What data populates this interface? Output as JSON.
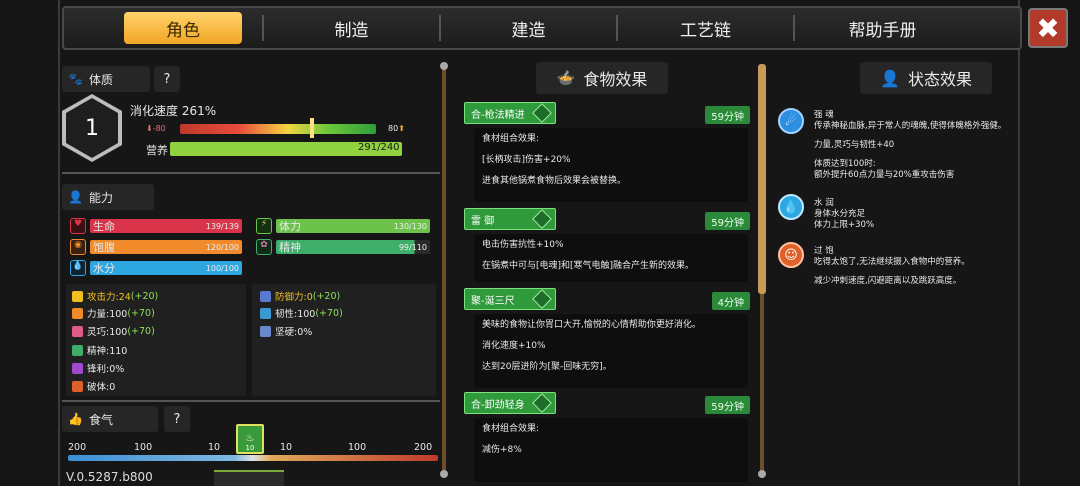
{
  "tabs": [
    "角色",
    "制造",
    "建造",
    "工艺链",
    "帮助手册"
  ],
  "close_symbol": "✖",
  "constitution": {
    "label": "体质",
    "help": "?",
    "level": "1",
    "digest_speed": "消化速度 261%",
    "digest_min": "-80",
    "digest_max": "80",
    "nutrition_label": "营养",
    "nutrition_value": "291/240",
    "nutrition_fraction": 1.0
  },
  "ability": {
    "label": "能力",
    "bars": [
      {
        "name": "生命",
        "value": "139/139",
        "color": "#d9344a"
      },
      {
        "name": "体力",
        "value": "130/130",
        "color": "#6cc24a"
      },
      {
        "name": "饱腹",
        "value": "120/100",
        "color": "#f08a2a"
      },
      {
        "name": "精神",
        "value": "99/110",
        "color": "#3fae6a"
      },
      {
        "name": "水分",
        "value": "100/100",
        "color": "#2ea7e0"
      }
    ],
    "attrs_left": [
      {
        "text": "攻击力:24",
        "bonus": "(+20)",
        "color": "#f0c020"
      },
      {
        "text": "力量:100",
        "bonus": "(+70)",
        "color": "#f08a2a"
      },
      {
        "text": "灵巧:100",
        "bonus": "(+70)",
        "color": "#e05a8a"
      },
      {
        "text": "精神:110",
        "bonus": "",
        "color": "#3fae6a"
      },
      {
        "text": "锋利:0%",
        "bonus": "",
        "color": "#a04ad0"
      },
      {
        "text": "破体:0",
        "bonus": "",
        "color": "#e0602a"
      }
    ],
    "attrs_right": [
      {
        "text": "防御力:0",
        "bonus": "(+20)",
        "color": "#5a7ad0"
      },
      {
        "text": "韧性:100",
        "bonus": "(+70)",
        "color": "#3a9ad0"
      },
      {
        "text": "坚硬:0%",
        "bonus": "",
        "color": "#6a8ad0"
      }
    ]
  },
  "food_qi": {
    "label": "食气",
    "help": "?",
    "scale": [
      "200",
      "100",
      "10",
      "10",
      "100",
      "200"
    ],
    "marker": "10"
  },
  "version": "V.0.5287.b800",
  "food_effects": {
    "title": "食物效果",
    "items": [
      {
        "name": "合-枪法精进",
        "time": "59分钟",
        "lines": [
          "食材组合效果:",
          "[长柄攻击]伤害+20%",
          "进食其他锅煮食物后效果会被替换。"
        ]
      },
      {
        "name": "雷 御",
        "time": "59分钟",
        "lines": [
          "电击伤害抗性+10%",
          "在锅煮中可与[电魂]和[寒气电触]融合产生新的效果。"
        ]
      },
      {
        "name": "聚-涎三尺",
        "time": "4分钟",
        "lines": [
          "美味的食物让你胃口大开,愉悦的心情帮助你更好消化。",
          "消化速度+10%",
          "达到20层进阶为[聚-回味无穷]。"
        ]
      },
      {
        "name": "合-卸劲轻身",
        "time": "59分钟",
        "lines": [
          "食材组合效果:",
          "减伤+8%"
        ]
      }
    ]
  },
  "status_effects": {
    "title": "状态效果",
    "items": [
      {
        "lines": [
          "强 魂",
          "传承神秘血脉,异于常人的魂魄,使得体魄格外强健。",
          "力量,灵巧与韧性+40",
          "体质达到100时:",
          "额外提升60点力量与20%重攻击伤害"
        ],
        "color": "#2e8ee0"
      },
      {
        "lines": [
          "水 润",
          "身体水分充足",
          "体力上限+30%"
        ],
        "color": "#2ea7e0"
      },
      {
        "lines": [
          "过 饱",
          "吃得太饱了,无法继续摄入食物中的营养。",
          "减少冲刺速度,闪避距离以及跳跃高度。"
        ],
        "color": "#e0602a"
      }
    ]
  }
}
